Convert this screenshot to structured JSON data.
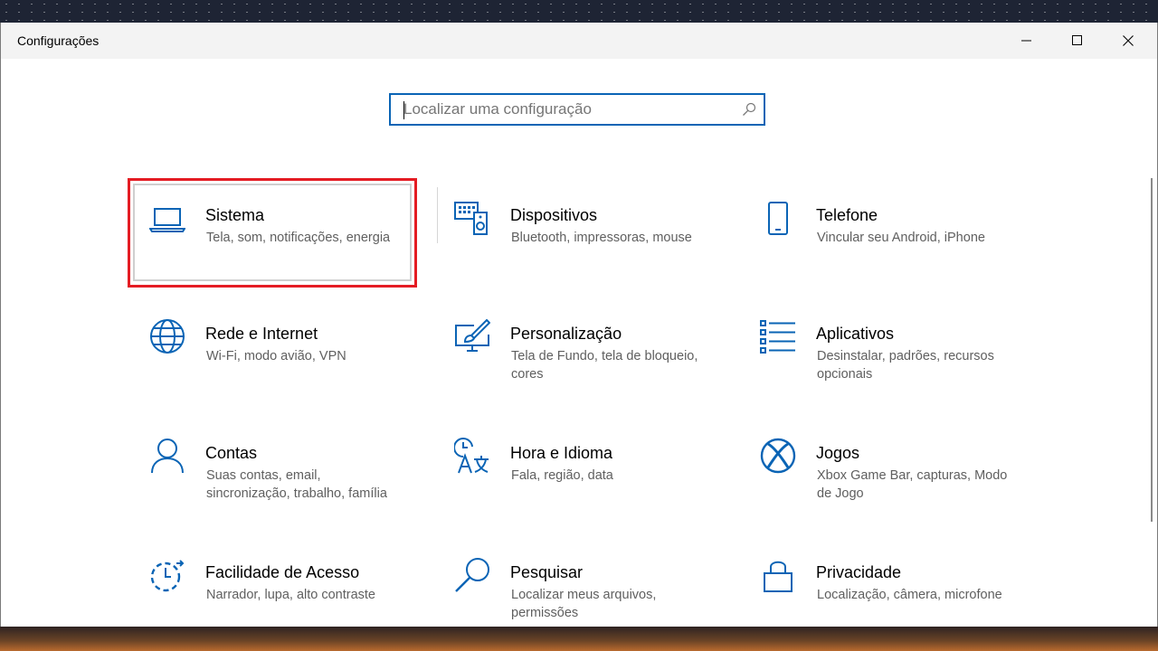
{
  "window": {
    "title": "Configurações"
  },
  "search": {
    "placeholder": "Localizar uma configuração"
  },
  "tiles": [
    {
      "name": "Sistema",
      "desc": "Tela, som, notificações, energia",
      "icon": "laptop-icon"
    },
    {
      "name": "Dispositivos",
      "desc": "Bluetooth, impressoras, mouse",
      "icon": "devices-icon"
    },
    {
      "name": "Telefone",
      "desc": "Vincular seu Android, iPhone",
      "icon": "phone-icon"
    },
    {
      "name": "Rede e Internet",
      "desc": "Wi-Fi, modo avião, VPN",
      "icon": "globe-icon"
    },
    {
      "name": "Personalização",
      "desc": "Tela de Fundo, tela de bloqueio, cores",
      "icon": "paintbrush-icon"
    },
    {
      "name": "Aplicativos",
      "desc": "Desinstalar, padrões, recursos opcionais",
      "icon": "apps-list-icon"
    },
    {
      "name": "Contas",
      "desc": "Suas contas, email, sincronização, trabalho, família",
      "icon": "person-icon"
    },
    {
      "name": "Hora e Idioma",
      "desc": "Fala, região, data",
      "icon": "time-language-icon"
    },
    {
      "name": "Jogos",
      "desc": "Xbox Game Bar, capturas, Modo de Jogo",
      "icon": "xbox-icon"
    },
    {
      "name": "Facilidade de Acesso",
      "desc": "Narrador, lupa, alto contraste",
      "icon": "ease-of-access-icon"
    },
    {
      "name": "Pesquisar",
      "desc": "Localizar meus arquivos, permissões",
      "icon": "search-icon"
    },
    {
      "name": "Privacidade",
      "desc": "Localização, câmera, microfone",
      "icon": "lock-icon"
    }
  ],
  "colors": {
    "accent": "#0a64b5",
    "highlight": "#e41c23"
  }
}
